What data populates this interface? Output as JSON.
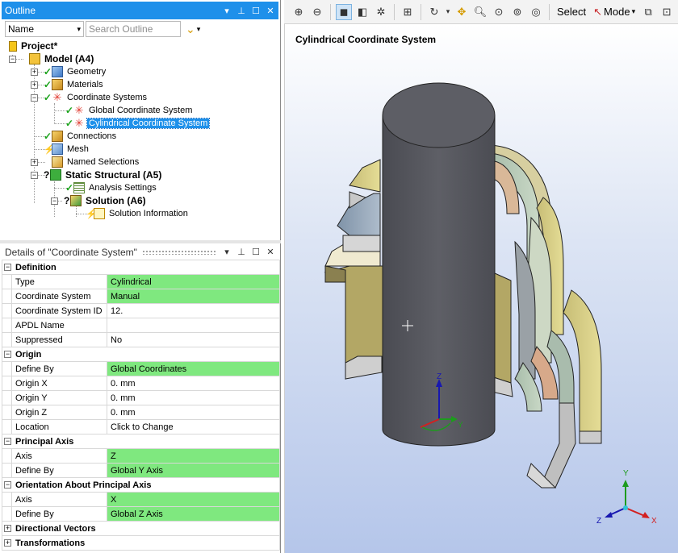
{
  "outline": {
    "title": "Outline",
    "filter_combo": "Name",
    "search_placeholder": "Search Outline",
    "tree": {
      "project": "Project*",
      "model": "Model (A4)",
      "geometry": "Geometry",
      "materials": "Materials",
      "coordinate_systems": "Coordinate Systems",
      "global_cs": "Global Coordinate System",
      "cylindrical_cs": "Cylindrical Coordinate System",
      "connections": "Connections",
      "mesh": "Mesh",
      "named_selections": "Named Selections",
      "static_structural": "Static Structural (A5)",
      "analysis_settings": "Analysis Settings",
      "solution": "Solution (A6)",
      "solution_information": "Solution Information"
    }
  },
  "details": {
    "title": "Details of \"Coordinate System\"",
    "groups": [
      {
        "label": "Definition",
        "rows": [
          {
            "key": "Type",
            "value": "Cylindrical",
            "highlight": true
          },
          {
            "key": "Coordinate System",
            "value": "Manual",
            "highlight": true
          },
          {
            "key": "Coordinate System ID",
            "value": "12.",
            "highlight": false
          },
          {
            "key": "APDL Name",
            "value": "",
            "highlight": false
          },
          {
            "key": "Suppressed",
            "value": "No",
            "highlight": false
          }
        ]
      },
      {
        "label": "Origin",
        "rows": [
          {
            "key": "Define By",
            "value": "Global Coordinates",
            "highlight": true
          },
          {
            "key": "Origin X",
            "value": "0. mm",
            "highlight": false
          },
          {
            "key": "Origin Y",
            "value": "0. mm",
            "highlight": false
          },
          {
            "key": "Origin Z",
            "value": "0. mm",
            "highlight": false
          },
          {
            "key": "Location",
            "value": "Click to Change",
            "highlight": false
          }
        ]
      },
      {
        "label": "Principal Axis",
        "rows": [
          {
            "key": "Axis",
            "value": "Z",
            "highlight": true
          },
          {
            "key": "Define By",
            "value": "Global Y Axis",
            "highlight": true
          }
        ]
      },
      {
        "label": "Orientation About Principal Axis",
        "rows": [
          {
            "key": "Axis",
            "value": "X",
            "highlight": true
          },
          {
            "key": "Define By",
            "value": "Global Z Axis",
            "highlight": true
          }
        ]
      },
      {
        "label": "Directional Vectors",
        "rows": []
      },
      {
        "label": "Transformations",
        "rows": []
      }
    ]
  },
  "toolbar": {
    "select_label": "Select",
    "mode_label": "Mode"
  },
  "viewport": {
    "title": "Cylindrical Coordinate System",
    "triad_local": {
      "x": "",
      "y": "Y",
      "z": "Z"
    },
    "triad_global": {
      "x": "X",
      "y": "Y",
      "z": "Z"
    }
  },
  "colors": {
    "selection_blue": "#1e90ea",
    "highlight_green": "#7fe87f",
    "cylinder_gray": "#56575e"
  }
}
